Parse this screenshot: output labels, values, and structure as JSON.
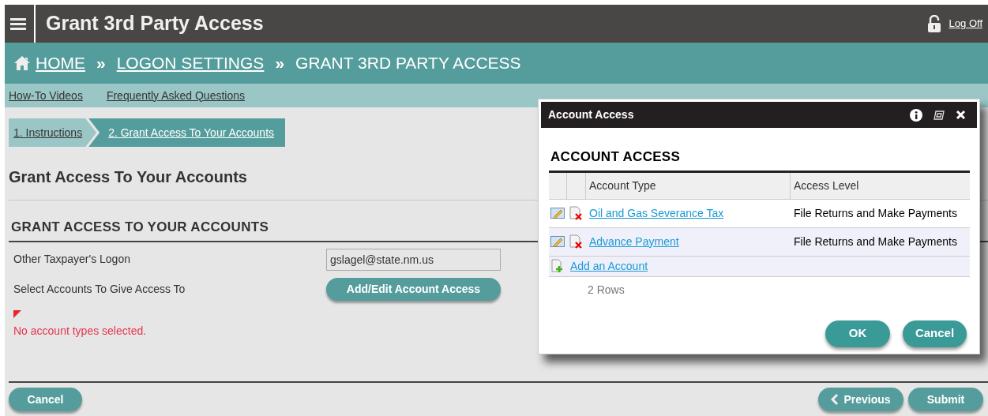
{
  "header": {
    "title": "Grant 3rd Party Access",
    "logoff": "Log Off"
  },
  "breadcrumb": [
    {
      "label": "HOME",
      "link": true
    },
    {
      "separator": "»",
      "label": "LOGON SETTINGS",
      "link": true
    },
    {
      "separator": "»",
      "label": "GRANT 3RD PARTY ACCESS",
      "link": false
    }
  ],
  "help_links": [
    "How-To Videos",
    "Frequently Asked Questions"
  ],
  "steps": [
    {
      "label": "1. Instructions",
      "selected": false
    },
    {
      "label": "2. Grant Access To Your Accounts",
      "selected": true
    }
  ],
  "page_heading": "Grant Access To Your Accounts",
  "section": {
    "title": "GRANT ACCESS TO YOUR ACCOUNTS",
    "logon_label": "Other Taxpayer's Logon",
    "logon_value": "gslagel@state.nm.us",
    "select_label": "Select Accounts To Give Access To",
    "select_button": "Add/Edit Account Access",
    "error": "No account types selected."
  },
  "footer": {
    "cancel": "Cancel",
    "previous": "Previous",
    "submit": "Submit"
  },
  "dialog": {
    "title": "Account Access",
    "heading": "ACCOUNT ACCESS",
    "columns": [
      "Account Type",
      "Access Level"
    ],
    "rows": [
      {
        "account_type": "Oil and Gas Severance Tax",
        "access_level": "File Returns and Make Payments"
      },
      {
        "account_type": "Advance Payment",
        "access_level": "File Returns and Make Payments"
      }
    ],
    "add_link": "Add an Account",
    "row_count": "2 Rows",
    "ok": "OK",
    "cancel": "Cancel"
  }
}
